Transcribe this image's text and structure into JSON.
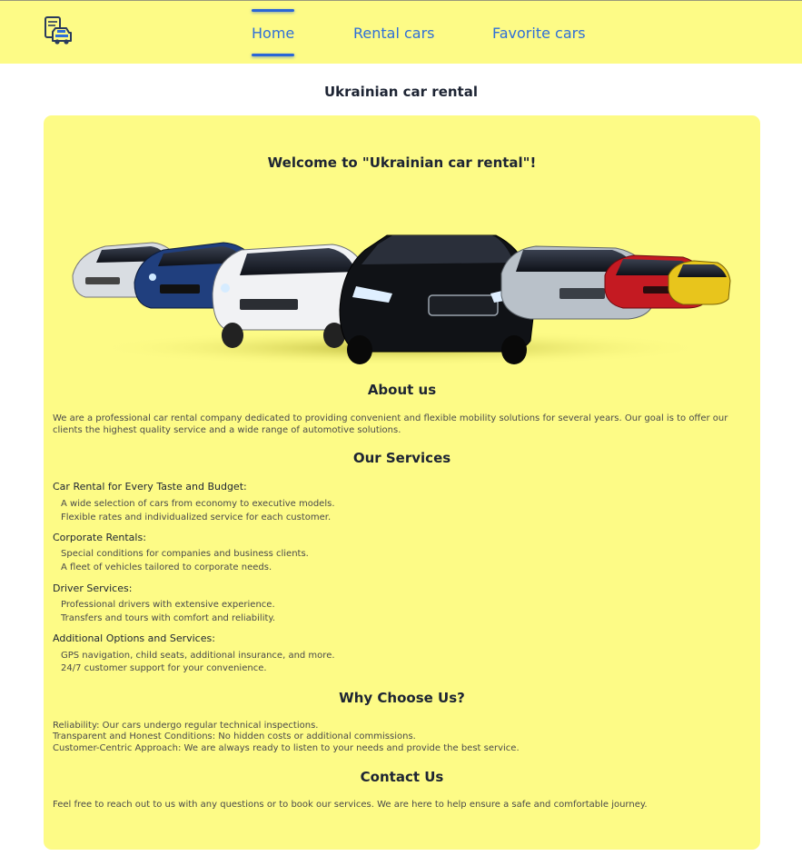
{
  "header": {
    "logo_icon": "car-rental-phone-icon",
    "nav": [
      {
        "label": "Home",
        "active": true
      },
      {
        "label": "Rental cars",
        "active": false
      },
      {
        "label": "Favorite cars",
        "active": false
      }
    ],
    "accent_color": "#2f6fd8",
    "background_color": "#fdfb86"
  },
  "page_title": "Ukrainian car rental",
  "main": {
    "welcome": "Welcome to \"Ukrainian car rental\"!",
    "hero_image": "lineup-of-cars",
    "about": {
      "heading": "About us",
      "text": "We are a professional car rental company dedicated to providing convenient and flexible mobility solutions for several years. Our goal is to offer our clients the highest quality service and a wide range of automotive solutions."
    },
    "services": {
      "heading": "Our Services",
      "groups": [
        {
          "title": "Car Rental for Every Taste and Budget:",
          "items": [
            "A wide selection of cars from economy to executive models.",
            "Flexible rates and individualized service for each customer."
          ]
        },
        {
          "title": "Corporate Rentals:",
          "items": [
            "Special conditions for companies and business clients.",
            "A fleet of vehicles tailored to corporate needs."
          ]
        },
        {
          "title": "Driver Services:",
          "items": [
            "Professional drivers with extensive experience.",
            "Transfers and tours with comfort and reliability."
          ]
        },
        {
          "title": "Additional Options and Services:",
          "items": [
            "GPS navigation, child seats, additional insurance, and more.",
            "24/7 customer support for your convenience."
          ]
        }
      ]
    },
    "why": {
      "heading": "Why Choose Us?",
      "items": [
        "Reliability: Our cars undergo regular technical inspections.",
        "Transparent and Honest Conditions: No hidden costs or additional commissions.",
        "Customer-Centric Approach: We are always ready to listen to your needs and provide the best service."
      ]
    },
    "contact": {
      "heading": "Contact Us",
      "text": "Feel free to reach out to us with any questions or to book our services. We are here to help ensure a safe and comfortable journey."
    }
  }
}
